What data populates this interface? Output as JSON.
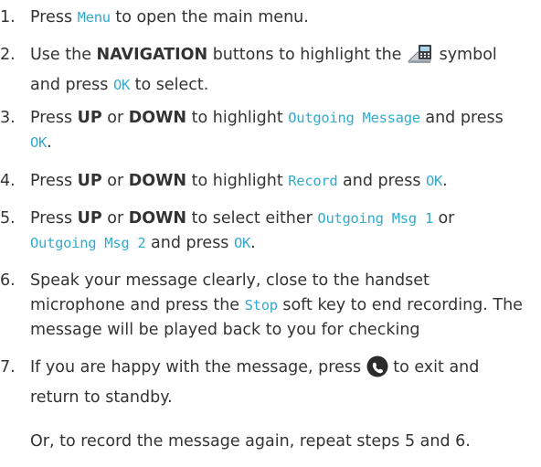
{
  "steps": [
    {
      "number": "1.",
      "parts": {
        "a": "Press ",
        "b": "Menu",
        "c": " to open the main menu."
      }
    },
    {
      "number": "2.",
      "parts": {
        "a": "Use the ",
        "b": "NAVIGATION",
        "c": " buttons to highlight the ",
        "icon": "messaging-symbol-icon",
        "d": " symbol and press ",
        "e": "OK",
        "f": " to select."
      }
    },
    {
      "number": "3.",
      "parts": {
        "a": "Press ",
        "b": "UP",
        "c": " or ",
        "d": "DOWN",
        "e": " to highlight ",
        "f": "Outgoing Message",
        "g": " and press ",
        "h": "OK",
        "i": "."
      }
    },
    {
      "number": "4.",
      "parts": {
        "a": "Press ",
        "b": "UP",
        "c": " or ",
        "d": "DOWN",
        "e": " to highlight ",
        "f": "Record",
        "g": " and press ",
        "h": "OK",
        "i": "."
      }
    },
    {
      "number": "5.",
      "parts": {
        "a": "Press ",
        "b": "UP",
        "c": " or ",
        "d": "DOWN",
        "e": " to select either ",
        "f": "Outgoing Msg 1",
        "g": " or ",
        "h": "Outgoing Msg 2",
        "i": " and press ",
        "j": "OK",
        "k": "."
      }
    },
    {
      "number": "6.",
      "parts": {
        "a": "Speak your message clearly, close to the handset microphone and press the ",
        "b": "Stop",
        "c": " soft key to end recording. The message will be played back to you for checking"
      }
    },
    {
      "number": "7.",
      "parts": {
        "a": "If you are happy with the message, press ",
        "icon": "end-call-icon",
        "b": " to exit and return to standby."
      },
      "note": "Or, to record the message again, repeat steps 5 and 6."
    }
  ],
  "colors": {
    "text": "#333333",
    "lcd_text": "#33aacc",
    "end_call_button": "#2b2b2b"
  }
}
